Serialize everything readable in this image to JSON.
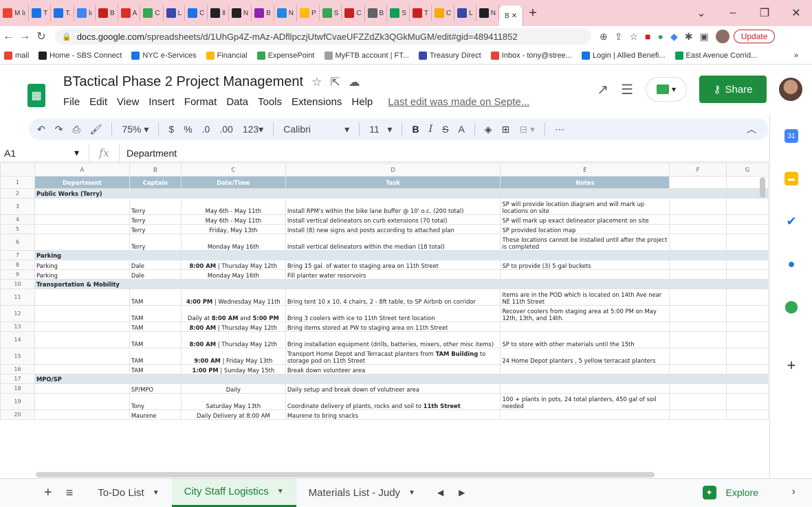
{
  "browser": {
    "tabs": [
      {
        "label": "M lı",
        "color": "#ea4335"
      },
      {
        "label": "T",
        "color": "#1a73e8"
      },
      {
        "label": "T.",
        "color": "#1a73e8"
      },
      {
        "label": "lı",
        "color": "#4285f4"
      },
      {
        "label": "B",
        "color": "#c5221f"
      },
      {
        "label": "A",
        "color": "#d93025"
      },
      {
        "label": "C",
        "color": "#34a853"
      },
      {
        "label": "L",
        "color": "#3949ab"
      },
      {
        "label": "C",
        "color": "#1a73e8"
      },
      {
        "label": "ll",
        "color": "#202124"
      },
      {
        "label": "N",
        "color": "#202124"
      },
      {
        "label": "B",
        "color": "#8e24aa"
      },
      {
        "label": "N",
        "color": "#1e88e5"
      },
      {
        "label": "P",
        "color": "#fbbc04"
      },
      {
        "label": "S",
        "color": "#34a853"
      },
      {
        "label": "C",
        "color": "#c5221f"
      },
      {
        "label": "B",
        "color": "#5f6368"
      },
      {
        "label": "S",
        "color": "#0f9d58"
      },
      {
        "label": "T",
        "color": "#c5221f"
      },
      {
        "label": "C",
        "color": "#f9ab00"
      },
      {
        "label": "L",
        "color": "#3949ab"
      },
      {
        "label": "N",
        "color": "#202124"
      }
    ],
    "active_tab": "B",
    "url_prefix": "docs.google.com",
    "url_rest": "/spreadsheets/d/1UhGp4Z-mAz-ADfllpczjUtwfCvaeUFZZdZk3QGkMuGM/edit#gid=489411852",
    "update_label": "Update",
    "bookmarks": [
      {
        "label": "mail",
        "color": "#ea4335"
      },
      {
        "label": "Home - SBS Connect",
        "color": "#202124"
      },
      {
        "label": "NYC e-Services",
        "color": "#1a73e8"
      },
      {
        "label": "Financial",
        "color": "#fbbc04"
      },
      {
        "label": "ExpensePoint",
        "color": "#34a853"
      },
      {
        "label": "MyFTB account | FT...",
        "color": "#9aa0a6"
      },
      {
        "label": "Treasury Direct",
        "color": "#3949ab"
      },
      {
        "label": "Inbox - tony@stree...",
        "color": "#ea4335"
      },
      {
        "label": "Login | Allied Benefi...",
        "color": "#1a73e8"
      },
      {
        "label": "East Avenue Corrid...",
        "color": "#0f9d58"
      }
    ],
    "more_bookmarks": "»"
  },
  "sheets": {
    "title": "BTactical Phase 2 Project Management",
    "menu": [
      "File",
      "Edit",
      "View",
      "Insert",
      "Format",
      "Data",
      "Tools",
      "Extensions",
      "Help"
    ],
    "last_edit": "Last edit was made on Septe...",
    "share_label": "Share",
    "toolbar": {
      "zoom": "75%",
      "currency": "$",
      "percent": "%",
      "dec_less": ".0",
      "dec_more": ".00",
      "format": "123",
      "font": "Calibri",
      "size": "11",
      "bold": "B",
      "italic": "I",
      "strike": "S",
      "textcolor": "A",
      "more": "⋯"
    },
    "namebox": "A1",
    "fx_label": "fx",
    "formula_value": "Department",
    "columns": [
      "A",
      "B",
      "C",
      "D",
      "E",
      "F",
      "G"
    ],
    "header_row": {
      "num": "1",
      "a": "Department",
      "b": "Captain",
      "c": "Date/Time",
      "d": "Task",
      "e": "Notes"
    },
    "rows": [
      {
        "num": "2",
        "type": "sec",
        "a": "Public Works (Terry)"
      },
      {
        "num": "3",
        "h": "r24",
        "a": "",
        "b": "Terry",
        "c": "May 6th - May 11th",
        "d": "Install RPM's within the bike lane buffer @ 10' o.c. (200 total)",
        "e": "SP will provide location diagram and will mark up locations on site"
      },
      {
        "num": "4",
        "h": "r14",
        "a": "",
        "b": "Terry",
        "c": "May 6th - May 11th",
        "d": "Install vertical delineators on curb extensions (70 total)",
        "e": "SP will mark up exact delineator placement on site"
      },
      {
        "num": "5",
        "h": "r14",
        "a": "",
        "b": "Terry",
        "c": "Friday, May 13th",
        "d": "Install (8) new signs and posts according to attached plan",
        "e": "SP provided location map"
      },
      {
        "num": "6",
        "h": "r24",
        "a": "",
        "b": "Terry",
        "c": "Monday May 16th",
        "d": "Install vertical delineators within the median (18 total)",
        "e": "These locations cannot be installed until after the project is completed"
      },
      {
        "num": "7",
        "type": "sec",
        "a": "Parking"
      },
      {
        "num": "8",
        "h": "r14",
        "a": "Parking",
        "b": "Dale",
        "c_bold": "8:00 AM",
        "c_rest": " | Thursday May 12th",
        "d": "Bring 15 gal. of water to staging area on 11th Street",
        "e": "SP to provide (3) 5-gal buckets"
      },
      {
        "num": "9",
        "h": "r14",
        "a": "Parking",
        "b": "Dale",
        "c": "Monday May 16th",
        "d": "Fill planter water resorvoirs",
        "e": ""
      },
      {
        "num": "10",
        "type": "sec",
        "a": "Transportation & Mobility"
      },
      {
        "num": "11",
        "h": "r24",
        "a": "",
        "b": "TAM",
        "c_bold": "4:00 PM",
        "c_rest": " | Wednesday May 11th",
        "d": "Bring tent 10 x 10, 4 chairs, 2 - 8ft table, to SP Airbnb on corridor",
        "e": "Items are in the POD which is located on 14th Ave near NE 11th Street"
      },
      {
        "num": "12",
        "h": "r24",
        "a": "",
        "b": "TAM",
        "c_pre": "Daily at ",
        "c_bold": "8:00 AM",
        "c_mid": " and ",
        "c_bold2": "5:00 PM",
        "d": "Bring 3 coolers with ice to 11th Street tent location",
        "e": "Recover coolers from staging area at 5:00 PM on May 12th, 13th, and 14th."
      },
      {
        "num": "13",
        "h": "r14",
        "a": "",
        "b": "TAM",
        "c_bold": "8:00 AM",
        "c_rest": " | Thursday May 12th",
        "d": "Bring items stored at PW to staging area on 11th Street",
        "e": ""
      },
      {
        "num": "14",
        "h": "r24",
        "a": "",
        "b": "TAM",
        "c_bold": "8:00 AM",
        "c_rest": " | Thursday May 12th",
        "d": "Bring installation equipment (drills, batteries, mixers, other misc items)",
        "e": "SP to store with other materials until the 15th"
      },
      {
        "num": "15",
        "h": "r24",
        "a": "",
        "b": "TAM",
        "c_bold": "9:00 AM",
        "c_rest": " | Friday May 13th",
        "d_pre": "Transport Home Depot and Terracast planters from ",
        "d_bold": "TAM Building",
        "d_post": " to storage pod on 11th Street",
        "e": "24 Home Depot planters , 5 yellow terracast planters"
      },
      {
        "num": "16",
        "h": "r14",
        "a": "",
        "b": "TAM",
        "c_bold": "1:00 PM",
        "c_rest": " | Sunday May 15th",
        "d": "Break down volunteer area",
        "e": ""
      },
      {
        "num": "17",
        "type": "sec",
        "a": "MPO/SP"
      },
      {
        "num": "18",
        "h": "r14",
        "a": "",
        "b": "SP/MPO",
        "c": "Daily",
        "d": "Daily setup and break down of volutneer area",
        "e": ""
      },
      {
        "num": "19",
        "h": "r24",
        "a": "",
        "b": "Tony",
        "c": "Saturday May 13th",
        "d_pre": "Coordinate delivery of plants, rocks and soil to ",
        "d_bold": "11th Street",
        "d_post": "",
        "e": "100 + plants in pots, 24 total planters, 450 gal of soil needed"
      },
      {
        "num": "20",
        "h": "r14",
        "a": "",
        "b": "Maurene",
        "c": "Daily Delivery at 8:00 AM",
        "d": "Maurene to bring snacks",
        "e": ""
      }
    ],
    "sheet_tabs": [
      {
        "label": "To-Do List",
        "active": false
      },
      {
        "label": "City Staff Logistics",
        "active": true
      },
      {
        "label": "Materials List - Judy",
        "active": false
      }
    ],
    "explore_label": "Explore"
  }
}
